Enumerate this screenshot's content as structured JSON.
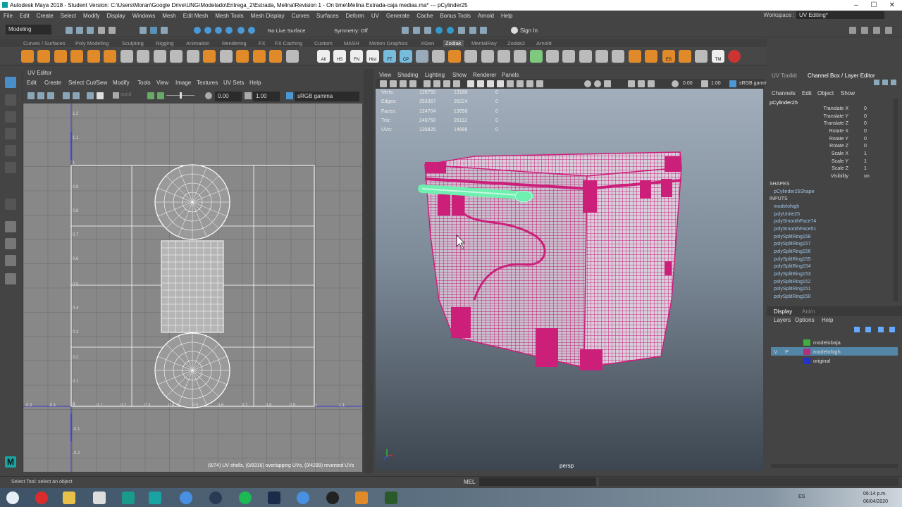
{
  "window": {
    "title": "Autodesk Maya 2018 - Student Version: C:\\Users\\Moran\\Google Drive\\UNG\\Modelado\\Entrega_2\\Estrada, Melina\\Revision 1 - On time\\Melina Estrada-caja medias.ma*  ---  pCylinder25",
    "minimize": "–",
    "maximize": "☐",
    "close": "✕"
  },
  "menubar": {
    "items": [
      "File",
      "Edit",
      "Create",
      "Select",
      "Modify",
      "Display",
      "Windows",
      "Mesh",
      "Edit Mesh",
      "Mesh Tools",
      "Mesh Display",
      "Curves",
      "Surfaces",
      "Deform",
      "UV",
      "Generate",
      "Cache",
      "Bonus Tools",
      "Arnold",
      "Help"
    ],
    "workspace_label": "Workspace :",
    "workspace_value": "UV Editing*"
  },
  "statusline": {
    "mode": "Modeling",
    "live_surface": "No Live Surface",
    "symmetry": "Symmetry: Off",
    "sign_in": "Sign In"
  },
  "shelf": {
    "tabs": [
      "Curves / Surfaces",
      "Poly Modeling",
      "Sculpting",
      "Rigging",
      "Animation",
      "Rendering",
      "FX",
      "FX Caching",
      "Custom",
      "MASH",
      "Motion Graphics",
      "XGen",
      "Zodiak",
      "MentalRay",
      "Zodak2",
      "Arnold"
    ],
    "active_tab": "Zodiak",
    "labels": [
      "All",
      "HS",
      "FN",
      "Hist",
      "FT",
      "CP",
      "ES",
      "TM"
    ]
  },
  "uv_editor": {
    "title": "UV Editor",
    "menu": [
      "Edit",
      "Create",
      "Select",
      "Cut/Sew",
      "Modify",
      "Tools",
      "View",
      "Image",
      "Textures",
      "UV Sets",
      "Help"
    ],
    "toolbar": {
      "value_a": "0.00",
      "value_b": "1.00",
      "colorspace": "sRGB gamma",
      "sound": "ound"
    },
    "axis_left": [
      "1.2",
      "1.1",
      "1",
      "0.9",
      "0.8",
      "0.7",
      "0.6",
      "0.5",
      "0.4",
      "0.3",
      "0.2",
      "0.1",
      "0",
      "-0.1",
      "-0.2"
    ],
    "axis_bottom": [
      "-0.2",
      "-0.1",
      "0",
      "0.1",
      "0.2",
      "0.3",
      "0.4",
      "0.5",
      "0.6",
      "0.7",
      "0.8",
      "0.9",
      "1",
      "1.1"
    ],
    "footer": "(0/74) UV shells, (0/8316) overlapping UVs, (0/4299) reversed UVs"
  },
  "viewport": {
    "menu": [
      "View",
      "Shading",
      "Lighting",
      "Show",
      "Renderer",
      "Panels"
    ],
    "near": "0.00",
    "far": "1.00",
    "colorspace": "sRGB gamm",
    "hud": [
      {
        "k": "Verts:",
        "a": "128750",
        "b": "13180",
        "c": "0"
      },
      {
        "k": "Edges:",
        "a": "253367",
        "b": "26224",
        "c": "0"
      },
      {
        "k": "Faces:",
        "a": "124704",
        "b": "13056",
        "c": "0"
      },
      {
        "k": "Tris:",
        "a": "249750",
        "b": "26112",
        "c": "0"
      },
      {
        "k": "UVs:",
        "a": "139825",
        "b": "14686",
        "c": "0"
      }
    ],
    "camera": "persp",
    "mesh_color": "#cc1f7a",
    "highlight_color": "#6fefb0"
  },
  "channel_box": {
    "tabs": [
      "UV Toolkit",
      "Channel Box / Layer Editor"
    ],
    "menu": [
      "Channels",
      "Edit",
      "Object",
      "Show"
    ],
    "object": "pCylinder25",
    "channels": [
      {
        "name": "Translate X",
        "value": "0"
      },
      {
        "name": "Translate Y",
        "value": "0"
      },
      {
        "name": "Translate Z",
        "value": "0"
      },
      {
        "name": "Rotate X",
        "value": "0"
      },
      {
        "name": "Rotate Y",
        "value": "0"
      },
      {
        "name": "Rotate Z",
        "value": "0"
      },
      {
        "name": "Scale X",
        "value": "1"
      },
      {
        "name": "Scale Y",
        "value": "1"
      },
      {
        "name": "Scale Z",
        "value": "1"
      },
      {
        "name": "Visibility",
        "value": "on"
      }
    ],
    "shapes_label": "SHAPES",
    "shape": "pCylinder25Shape",
    "inputs_label": "INPUTS",
    "inputs": [
      "modelohigh",
      "polyUnite25",
      "polySmoothFace74",
      "polySmoothFace51",
      "polySplitRing158",
      "polySplitRing157",
      "polySplitRing156",
      "polySplitRing155",
      "polySplitRing154",
      "polySplitRing153",
      "polySplitRing152",
      "polySplitRing151",
      "polySplitRing150"
    ]
  },
  "layer_editor": {
    "tabs": [
      "Display",
      "Anim"
    ],
    "menu": [
      "Layers",
      "Options",
      "Help"
    ],
    "layers": [
      {
        "name": "modelobaja",
        "color": "#3fae3f",
        "v": "",
        "p": ""
      },
      {
        "name": "modelohigh",
        "color": "#b0307a",
        "v": "V",
        "p": "P"
      },
      {
        "name": "original",
        "color": "#2233cc",
        "v": "",
        "p": ""
      }
    ]
  },
  "helpline": {
    "text": "Select Tool: select an object",
    "mel": "MEL"
  },
  "taskbar": {
    "lang": "ES",
    "time": "06:14 p.m.",
    "date": "06/04/2020"
  }
}
